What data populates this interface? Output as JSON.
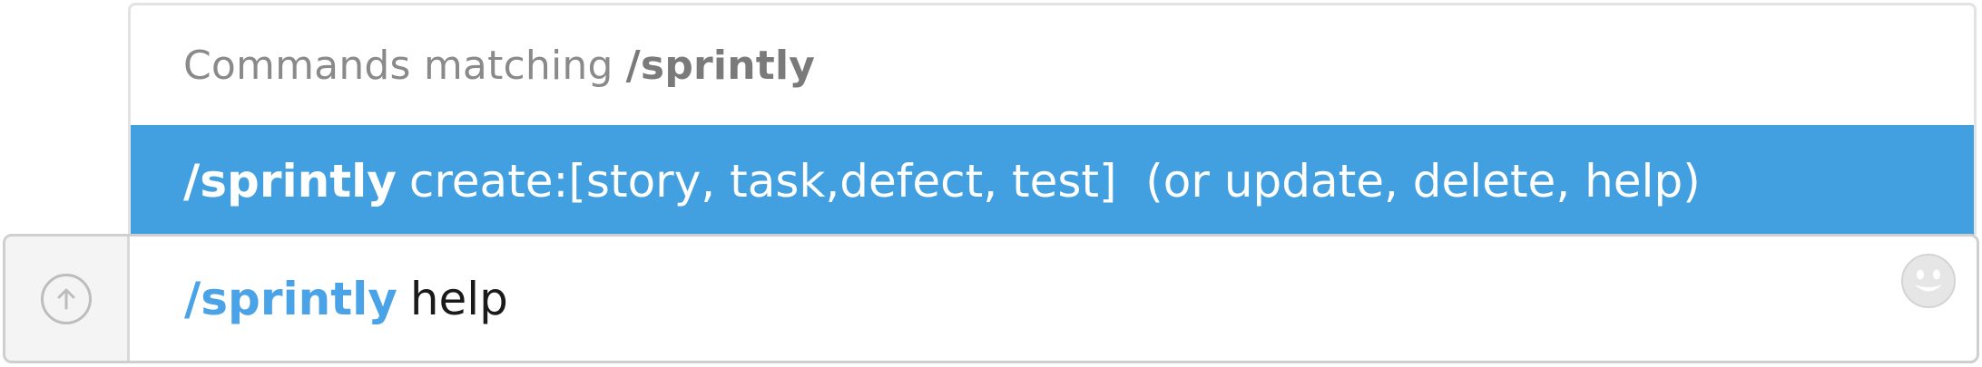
{
  "popup": {
    "header_prefix": "Commands matching",
    "header_command": "/sprintly",
    "option": {
      "command": "/sprintly",
      "description": "create:[story, task,defect, test]  (or update, delete, help)"
    },
    "highlight_color": "#42a0e1"
  },
  "input": {
    "command": "/sprintly",
    "argument": "help",
    "command_color": "#4aa3e6"
  },
  "icons": {
    "upload": "arrow-up-circle-icon",
    "emoji": "smiley-face-icon"
  }
}
